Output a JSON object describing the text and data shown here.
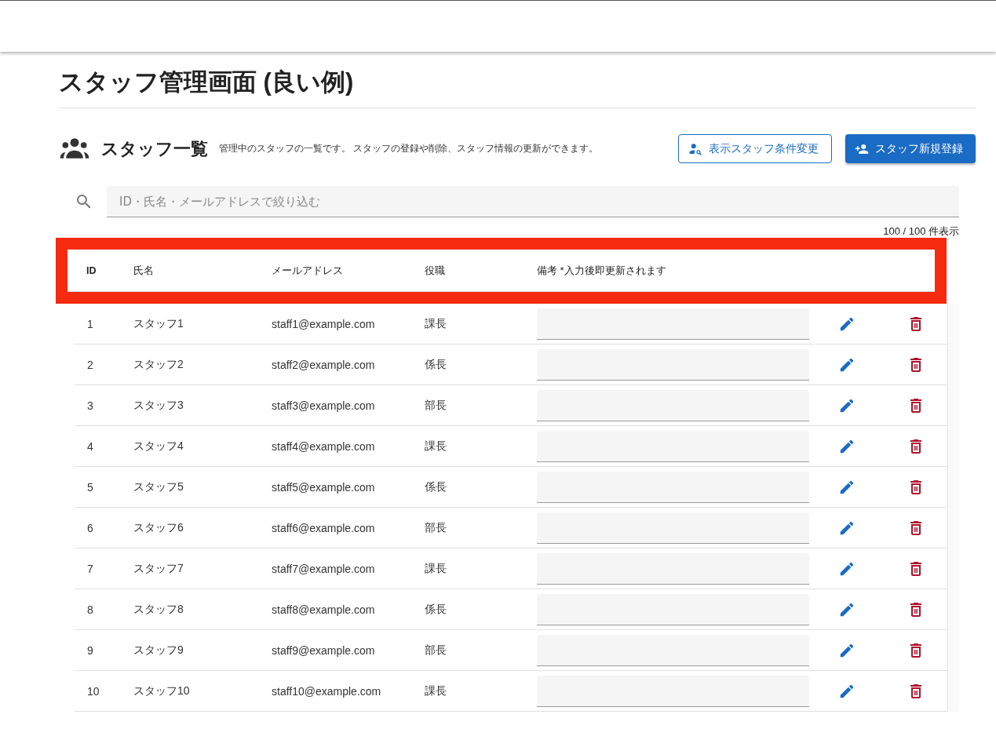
{
  "page_title": "スタッフ管理画面 (良い例)",
  "section": {
    "title": "スタッフ一覧",
    "description": "管理中のスタッフの一覧です。 スタッフの登録や削除、スタッフ情報の更新ができます。",
    "buttons": [
      {
        "label": "表示スタッフ条件変更",
        "kind": "outlined"
      },
      {
        "label": "スタッフ新規登録",
        "kind": "contained"
      }
    ]
  },
  "search": {
    "placeholder": "ID・氏名・メールアドレスで絞り込む"
  },
  "count": "100 / 100 件表示",
  "table": {
    "columns": [
      {
        "label": "ID"
      },
      {
        "label": "氏名"
      },
      {
        "label": "メールアドレス"
      },
      {
        "label": "役職"
      },
      {
        "label": "備考 *入力後即更新されます"
      }
    ],
    "rows": [
      {
        "id": "1",
        "name": "スタッフ1",
        "email": "staff1@example.com",
        "role": "課長"
      },
      {
        "id": "2",
        "name": "スタッフ2",
        "email": "staff2@example.com",
        "role": "係長"
      },
      {
        "id": "3",
        "name": "スタッフ3",
        "email": "staff3@example.com",
        "role": "部長"
      },
      {
        "id": "4",
        "name": "スタッフ4",
        "email": "staff4@example.com",
        "role": "課長"
      },
      {
        "id": "5",
        "name": "スタッフ5",
        "email": "staff5@example.com",
        "role": "係長"
      },
      {
        "id": "6",
        "name": "スタッフ6",
        "email": "staff6@example.com",
        "role": "部長"
      },
      {
        "id": "7",
        "name": "スタッフ7",
        "email": "staff7@example.com",
        "role": "課長"
      },
      {
        "id": "8",
        "name": "スタッフ8",
        "email": "staff8@example.com",
        "role": "係長"
      },
      {
        "id": "9",
        "name": "スタッフ9",
        "email": "staff9@example.com",
        "role": "部長"
      },
      {
        "id": "10",
        "name": "スタッフ10",
        "email": "staff10@example.com",
        "role": "課長"
      }
    ]
  }
}
